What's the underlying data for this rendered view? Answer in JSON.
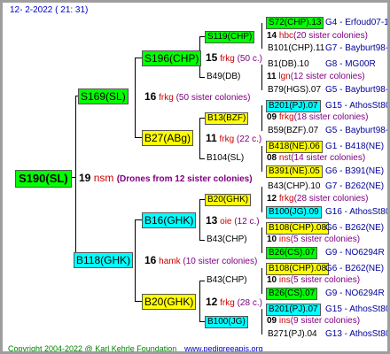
{
  "header": {
    "date": "12-  2-2022 ( 21: 31)"
  },
  "footer": {
    "copyright": "Copyright 2004-2022 @ Karl Kehrle Foundation",
    "url": "www.pedigreeapis.org"
  },
  "root": {
    "id": "S190(SL)",
    "num": "19",
    "sym": "nsm",
    "note": "(Drones from 12 sister colonies)"
  },
  "sire": {
    "id": "S169(SL)",
    "num": "16",
    "sym": "frkg",
    "note": "(50 sister colonies)"
  },
  "dam": {
    "id": "B118(GHK)",
    "num": "16",
    "sym": "hamk",
    "note": "(10 sister colonies)"
  },
  "g3": [
    {
      "id": "S196(CHP)",
      "num": "15",
      "sym": "frkg",
      "note": "(50 c.)"
    },
    {
      "id": "B27(ABg)",
      "num": "11",
      "sym": "frkg",
      "note": "(22 c.)"
    },
    {
      "id": "B16(GHK)",
      "num": "13",
      "sym": "oie",
      "note": "(12 c.)"
    },
    {
      "id": "B20(GHK)",
      "num": "12",
      "sym": "frkg",
      "note": "(28 c.)"
    }
  ],
  "g4": [
    {
      "id": "S119(CHP)",
      "num": "14",
      "sym": "hbc",
      "note": "(20 sister colonies)"
    },
    {
      "id": "B49(DB)",
      "num": "11",
      "sym": "lgn",
      "note": "(12 sister colonies)"
    },
    {
      "id": "B13(BZF)",
      "num": "09",
      "sym": "frkg",
      "note": "(18 sister colonies)"
    },
    {
      "id": "B104(SL)",
      "num": "08",
      "sym": "nst",
      "note": "(14 sister colonies)"
    },
    {
      "id": "B20(GHK)",
      "num": "12",
      "sym": "frkg",
      "note": "(28 sister colonies)"
    },
    {
      "id": "B43(CHP)",
      "num": "10",
      "sym": "ins",
      "note": "(5 sister colonies)"
    },
    {
      "id": "B43(CHP)",
      "num": "10",
      "sym": "ins",
      "note": "(5 sister colonies)"
    },
    {
      "id": "B100(JG)",
      "num": "09",
      "sym": "ins",
      "note": "(9 sister colonies)"
    }
  ],
  "g5": [
    {
      "id": "S72(CHP).13",
      "info": "G4 - Erfoud07-10"
    },
    {
      "id": "B101(CHP).11",
      "info": "G7 - Bayburt98-3"
    },
    {
      "id": "B1(DB).10",
      "info": "G8 - MG00R"
    },
    {
      "id": "B79(HGS).07",
      "info": "G5 - Bayburt98-3"
    },
    {
      "id": "B201(PJ).07",
      "info": "G15 - AthosSt80R"
    },
    {
      "id": "B59(BZF).07",
      "info": "G5 - Bayburt98-3"
    },
    {
      "id": "B418(NE).06",
      "info": "G1 - B418(NE)"
    },
    {
      "id": "B391(NE).05",
      "info": "G6 - B391(NE)"
    },
    {
      "id": "B43(CHP).10",
      "info": "G7 - B262(NE)"
    },
    {
      "id": "B100(JG).09",
      "info": "G16 - AthosSt80R"
    },
    {
      "id": "B108(CHP).08",
      "info": "G6 - B262(NE)"
    },
    {
      "id": "B26(CS).07",
      "info": "G9 - NO6294R"
    },
    {
      "id": "B108(CHP).08",
      "info": "G6 - B262(NE)"
    },
    {
      "id": "B26(CS).07",
      "info": "G9 - NO6294R"
    },
    {
      "id": "B201(PJ).07",
      "info": "G15 - AthosSt80R"
    },
    {
      "id": "B271(PJ).04",
      "info": "G13 - AthosSt80R"
    }
  ],
  "colors": {
    "green": "#00ff00",
    "yellow": "#ffff00",
    "cyan": "#00ffff",
    "sym_red": "#cc0000",
    "note_purple": "#800080",
    "info_blue": "#000099",
    "border": "#9e9e9e"
  }
}
